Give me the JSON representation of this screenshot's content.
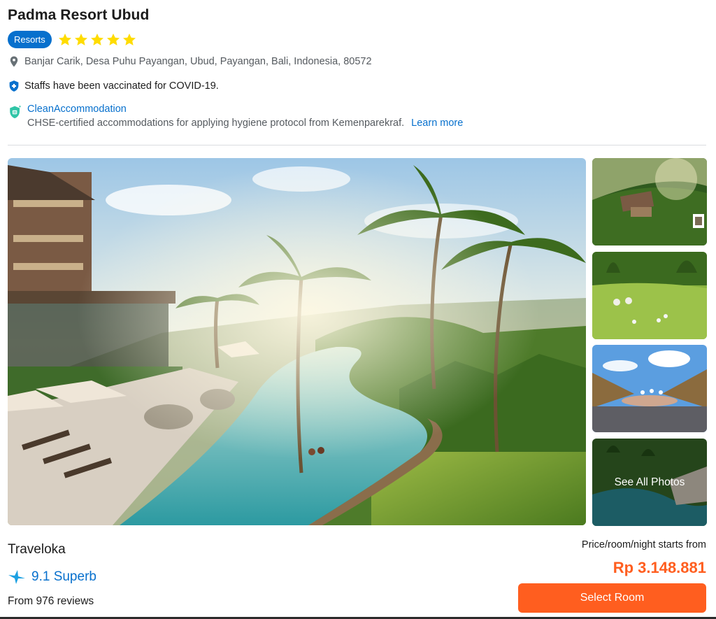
{
  "hotel": {
    "name": "Padma Resort Ubud",
    "type_badge": "Resorts",
    "star_rating": 5,
    "address": "Banjar Carik, Desa Puhu Payangan, Ubud, Payangan, Bali, Indonesia, 80572",
    "vaccination_note": "Staffs have been vaccinated for COVID-19.",
    "clean": {
      "title": "CleanAccommodation",
      "description": "CHSE-certified accommodations for applying hygiene protocol from Kemenparekraf.",
      "learn_more": "Learn more"
    }
  },
  "gallery": {
    "see_all_label": "See All Photos"
  },
  "footer": {
    "provider": "Traveloka",
    "rating_text": "9.1 Superb",
    "reviews_text": "From 976 reviews",
    "price_label": "Price/room/night starts from",
    "price": "Rp 3.148.881",
    "select_button": "Select Room"
  },
  "colors": {
    "brand_blue": "#0770cd",
    "accent_orange": "#ff5e1f",
    "star_yellow": "#ffdc00"
  }
}
